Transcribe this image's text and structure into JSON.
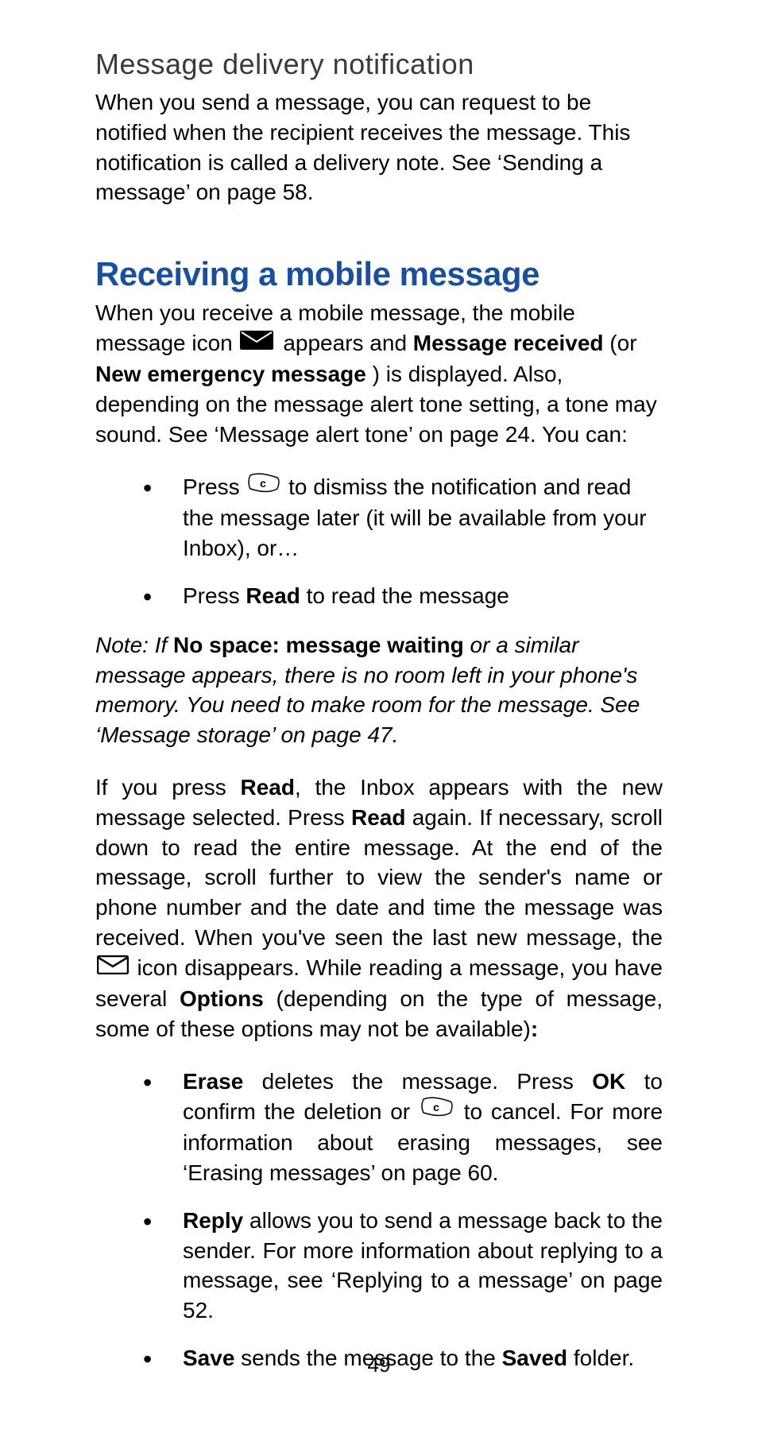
{
  "page_number": "49",
  "section1": {
    "heading": "Message delivery notification",
    "para": "When you send a message, you can request to be notified when the recipient receives the message. This notification is called a delivery note. See ‘Sending a message’ on page 58."
  },
  "section2": {
    "heading": "Receiving a mobile message",
    "intro_pre_icon": "When you receive a mobile message, the mobile message icon ",
    "intro_post_icon_1": " appears and ",
    "msg_received": "Message received",
    "intro_post_icon_2": " (or ",
    "new_emergency": "New emergency message",
    "intro_post_icon_3": ") is displayed. Also, depending on the message alert tone setting, a tone may sound. See ‘Message alert tone’ on page 24. You can:",
    "bullets1": [
      {
        "pre": "Press ",
        "post": " to dismiss the notification and read the message later (it will be available from your Inbox), or…"
      },
      {
        "pre": "Press ",
        "bold": "Read",
        "post": " to read the message"
      }
    ],
    "note_prefix": "Note: If ",
    "note_bold": "No space: message waiting",
    "note_rest": " or a similar message appears, there is no room left in your phone's memory. You need to make room for the message. See ‘Message storage’ on page 47.",
    "para2_a": "If you press ",
    "para2_read1": "Read",
    "para2_b": ", the Inbox appears with the new message selected. Press ",
    "para2_read2": "Read",
    "para2_c": " again. If necessary, scroll down to read the entire message. At the end of the message, scroll further to view the sender's name or phone number and the date and time the message was received. When you've seen the last new message, the ",
    "para2_d": " icon disappears. While reading a message, you have several ",
    "para2_options": "Options",
    "para2_e": " (depending on the type of message, some of these options may not be available)",
    "para2_colon": ":",
    "bullets2": [
      {
        "b1": "Erase",
        "t1": " deletes the message. Press ",
        "b2": "OK",
        "t2": " to confirm the deletion or ",
        "t3": " to cancel. For more information about erasing messages, see ‘Erasing messages’ on page 60."
      },
      {
        "b1": "Reply",
        "t1": " allows you to send a message back to the sender. For more information about replying to a message, see ‘Replying to a message’ on page 52."
      },
      {
        "b1": "Save",
        "t1": " sends the message to the ",
        "b2": "Saved",
        "t2": " folder."
      }
    ]
  }
}
